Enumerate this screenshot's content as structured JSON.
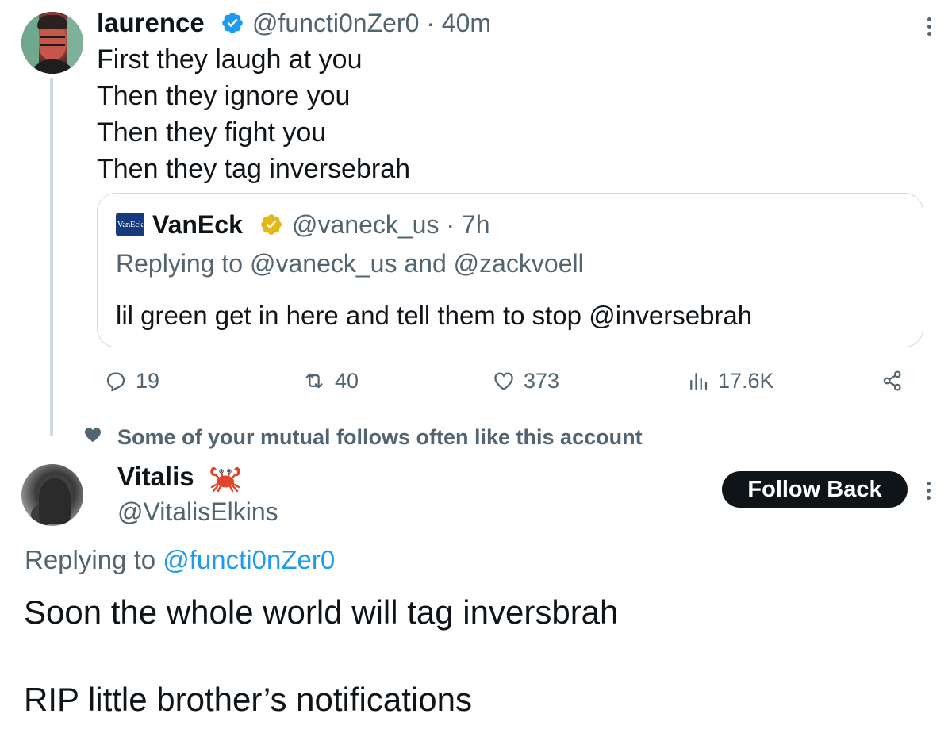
{
  "parent_tweet": {
    "author_name": "laurence",
    "meta": "@functi0nZer0 · 40m",
    "lines": [
      "First they laugh at you",
      "Then they ignore you",
      "Then they fight you",
      "Then they tag inversebrah"
    ],
    "verified_badge": "blue-check-badge-icon"
  },
  "quote_tweet": {
    "logo_text": "VanEck",
    "author_name": "VanEck",
    "meta": "@vaneck_us · 7h",
    "replying_to": "Replying to @vaneck_us and @zackvoell",
    "text": "lil green get in here and tell them to stop @inversebrah",
    "verified_badge": "gold-check-badge-icon"
  },
  "actions": {
    "replies": "19",
    "retweets": "40",
    "likes": "373",
    "views": "17.6K"
  },
  "social_context": {
    "text": "Some of your mutual follows often like this account"
  },
  "reply_tweet": {
    "author_name": "Vitalis",
    "emoji": "crab-emoji",
    "handle": "@VitalisElkins",
    "follow_label": "Follow Back",
    "replying_prefix": "Replying to ",
    "replying_mention": "@functi0nZer0",
    "text_line_1": "Soon the whole world will tag inversbrah",
    "text_line_2": "RIP little brother’s notifications"
  },
  "colors": {
    "text_primary": "#0f1419",
    "text_secondary": "#536471",
    "link": "#1d9bf0",
    "border": "#cfd9de",
    "verified_blue": "#1d9bf0",
    "verified_gold": "#e2b719",
    "follow_button_bg": "#0f1419"
  }
}
